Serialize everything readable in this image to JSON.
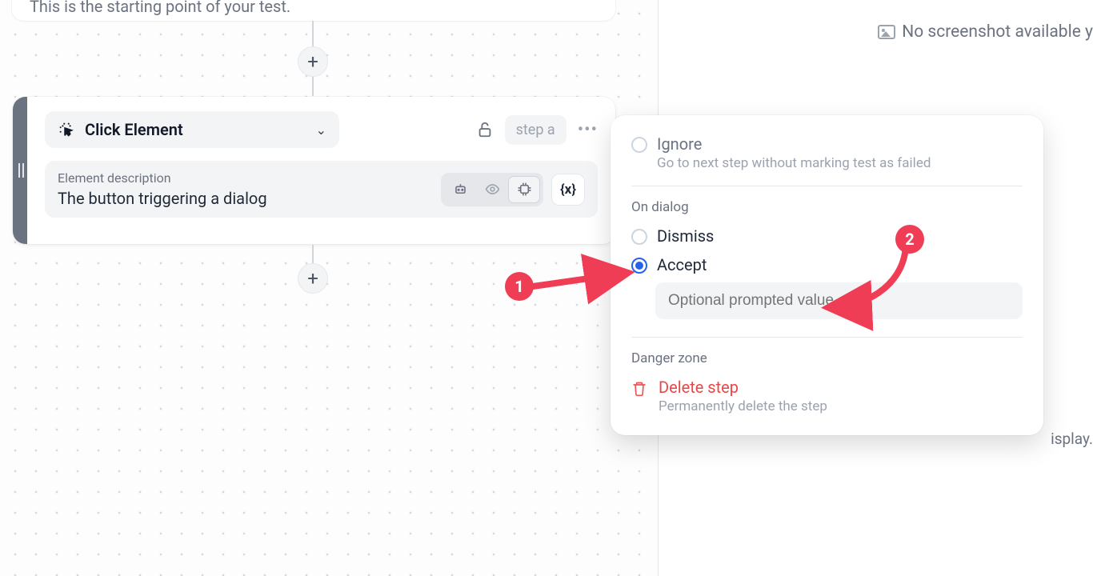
{
  "canvas": {
    "start_text": "This is the starting point of your test."
  },
  "right": {
    "no_screenshot": "No screenshot available y",
    "tail": "isplay."
  },
  "step": {
    "action_label": "Click Element",
    "badge": "step a",
    "desc_label": "Element description",
    "desc_value": "The button triggering a dialog",
    "var_btn": "{x}"
  },
  "popover": {
    "ignore_title": "Ignore",
    "ignore_sub": "Go to next step without marking test as failed",
    "on_dialog": "On dialog",
    "dismiss": "Dismiss",
    "accept": "Accept",
    "prompt_placeholder": "Optional prompted value",
    "danger": "Danger zone",
    "delete": "Delete step",
    "delete_sub": "Permanently delete the step"
  },
  "callouts": {
    "one": "1",
    "two": "2"
  }
}
